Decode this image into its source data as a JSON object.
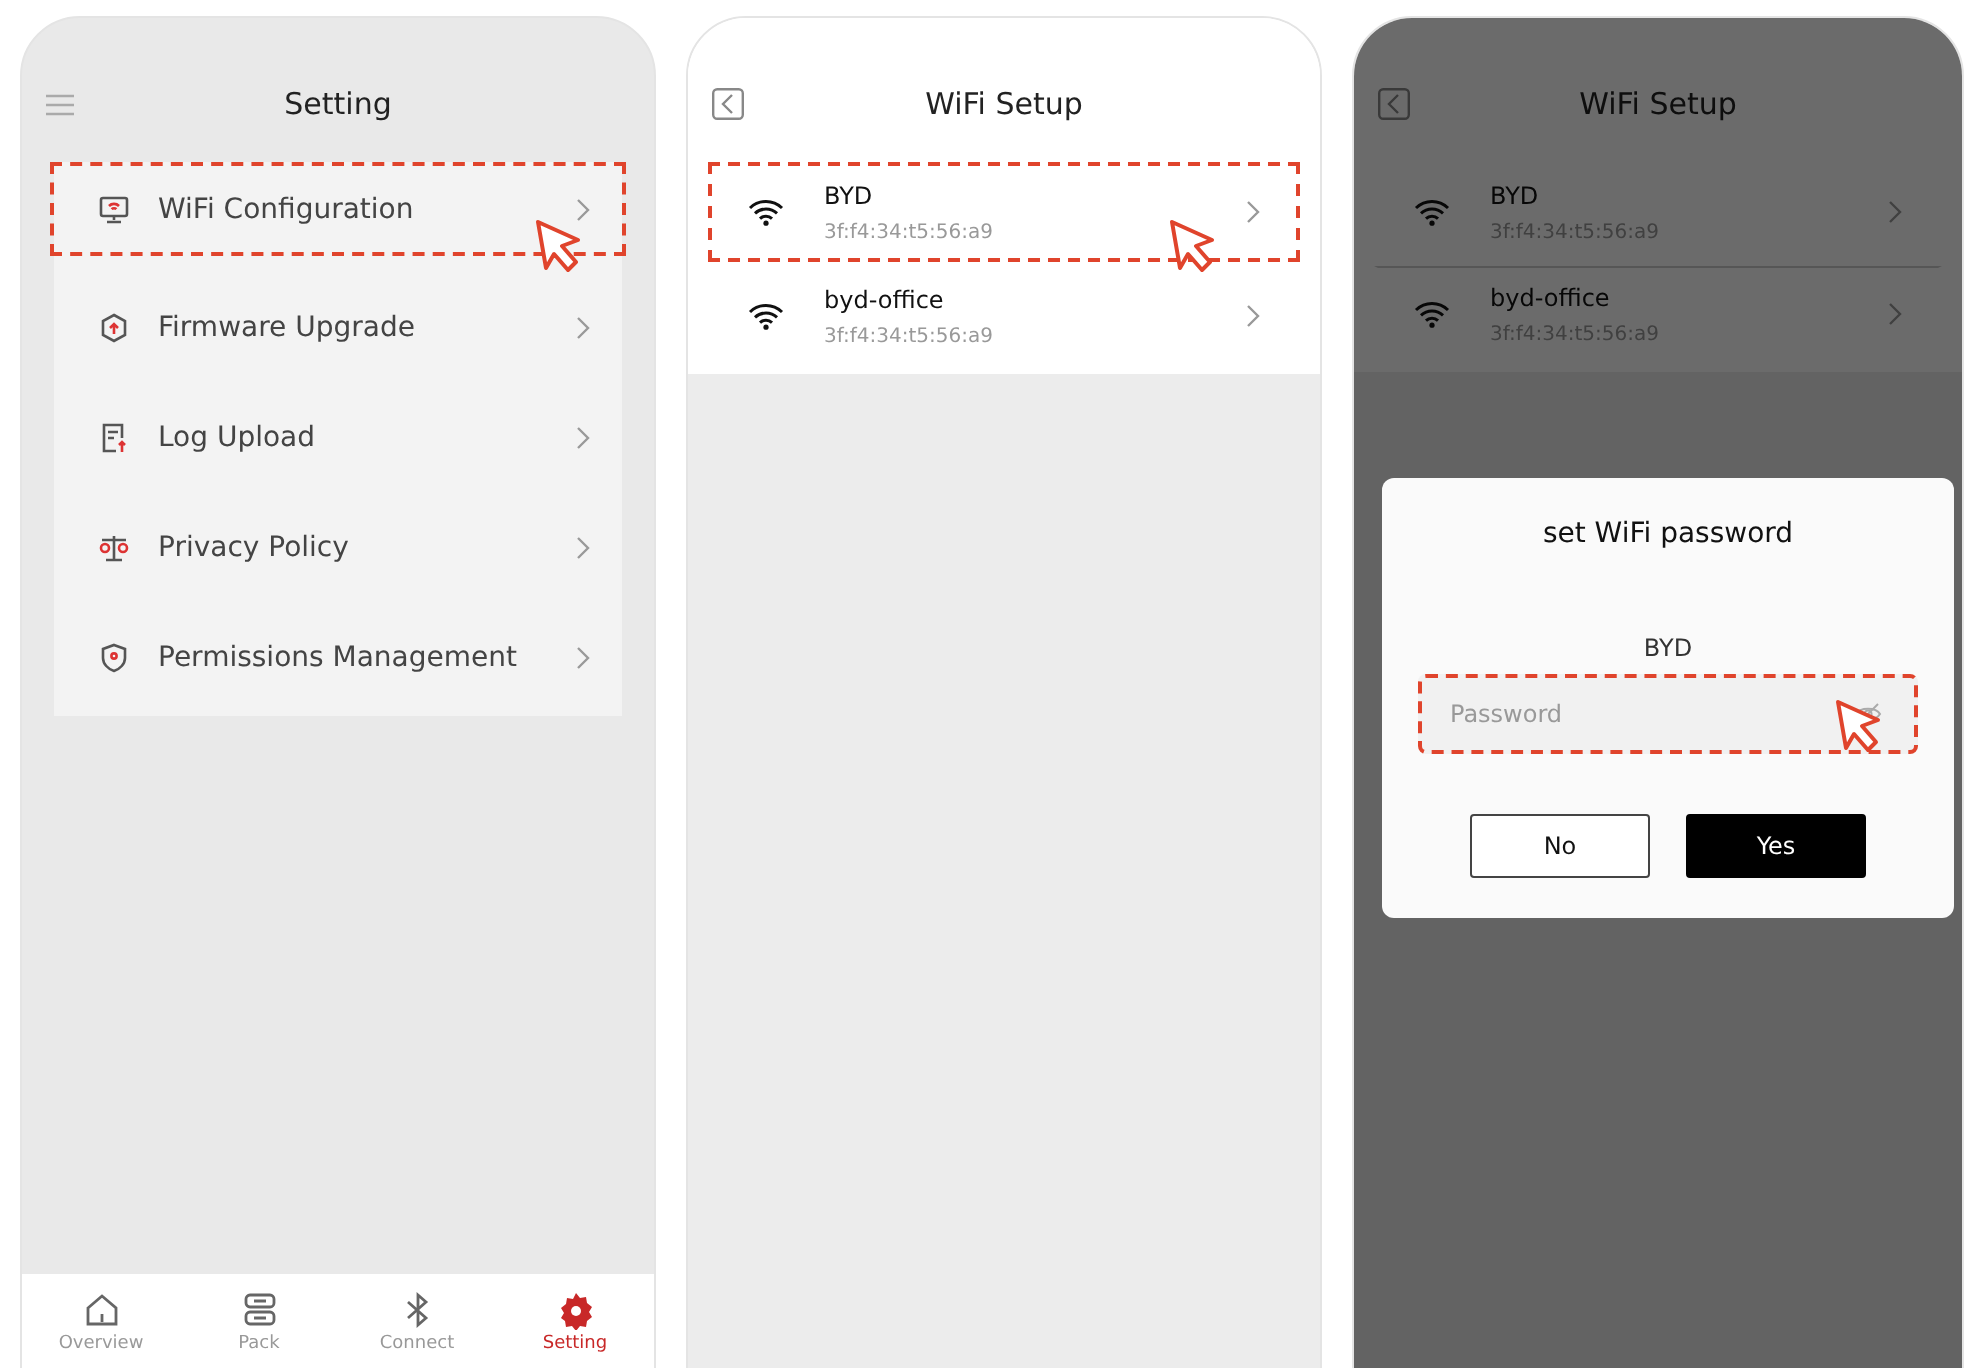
{
  "screens": [
    {
      "kind": "settings",
      "title": "Setting",
      "menu": [
        {
          "label": "WiFi Configuration",
          "highlighted": true
        },
        {
          "label": "Firmware Upgrade",
          "highlighted": false
        },
        {
          "label": "Log Upload",
          "highlighted": false
        },
        {
          "label": "Privacy Policy",
          "highlighted": false
        },
        {
          "label": "Permissions Management",
          "highlighted": false
        }
      ],
      "nav": [
        {
          "label": "Overview",
          "selected": false
        },
        {
          "label": "Pack",
          "selected": false
        },
        {
          "label": "Connect",
          "selected": false
        },
        {
          "label": "Setting",
          "selected": true
        }
      ]
    },
    {
      "kind": "wifi",
      "title": "WiFi Setup",
      "networks": [
        {
          "name": "BYD",
          "mac": "3f:f4:34:t5:56:a9",
          "highlighted": true
        },
        {
          "name": "byd-office",
          "mac": "3f:f4:34:t5:56:a9",
          "highlighted": false
        }
      ]
    },
    {
      "kind": "wifi",
      "title": "WiFi Setup",
      "networks": [
        {
          "name": "BYD",
          "mac": "3f:f4:34:t5:56:a9",
          "highlighted": false
        },
        {
          "name": "byd-office",
          "mac": "3f:f4:34:t5:56:a9",
          "highlighted": false
        }
      ],
      "dialog": {
        "title": "set WiFi password",
        "network": "BYD",
        "placeholder": "Password",
        "highlighted": true,
        "buttons": [
          {
            "label": "No",
            "kind": "secondary"
          },
          {
            "label": "Yes",
            "kind": "primary"
          }
        ]
      }
    }
  ]
}
